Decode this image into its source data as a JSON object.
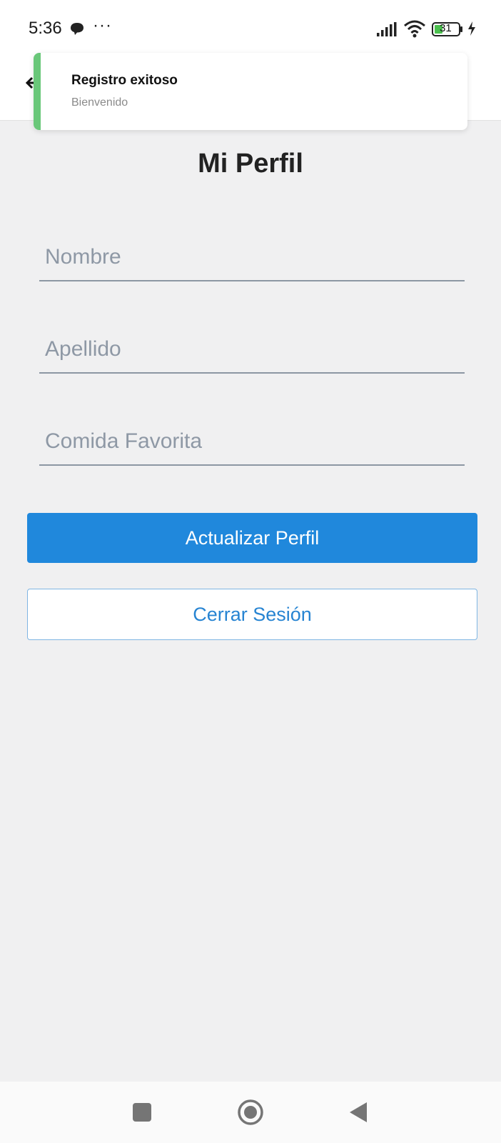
{
  "status_bar": {
    "time": "5:36",
    "more": "···",
    "battery_level": "31",
    "icons": [
      "message-icon",
      "signal-icon",
      "wifi-icon",
      "battery-icon",
      "charging-icon"
    ]
  },
  "header": {
    "back_icon": "back-arrow-icon"
  },
  "toast": {
    "title": "Registro exitoso",
    "subtitle": "Bienvenido",
    "accent_color": "#69c779"
  },
  "profile": {
    "title": "Mi Perfil",
    "fields": {
      "nombre": {
        "placeholder": "Nombre",
        "value": ""
      },
      "apellido": {
        "placeholder": "Apellido",
        "value": ""
      },
      "comida": {
        "placeholder": "Comida Favorita",
        "value": ""
      }
    },
    "update_button": "Actualizar Perfil",
    "logout_button": "Cerrar Sesión"
  },
  "nav_bar": {
    "icons": [
      "recents-icon",
      "home-icon",
      "back-icon"
    ]
  },
  "colors": {
    "primary": "#2088dc",
    "background": "#f0f0f1"
  }
}
